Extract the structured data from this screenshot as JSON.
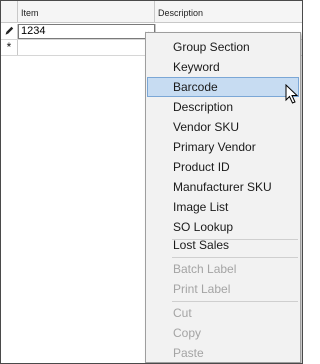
{
  "grid": {
    "columns": [
      "Item",
      "Description"
    ],
    "rows": [
      {
        "indicator_icon": "pencil-icon",
        "item": "1234",
        "description": ""
      }
    ],
    "new_row_icon": "asterisk-icon"
  },
  "context_menu": {
    "items": [
      "Group Section",
      "Keyword",
      "Barcode",
      "Description",
      "Vendor SKU",
      "Primary Vendor",
      "Product ID",
      "Manufacturer SKU",
      "Image List",
      "SO Lookup",
      "Lost Sales",
      "Batch Label",
      "Print Label",
      "Cut",
      "Copy",
      "Paste"
    ],
    "highlighted": "Barcode",
    "disabled": [
      "Batch Label",
      "Print Label",
      "Cut",
      "Copy",
      "Paste"
    ],
    "highlight_color": "#c7dcf2"
  }
}
